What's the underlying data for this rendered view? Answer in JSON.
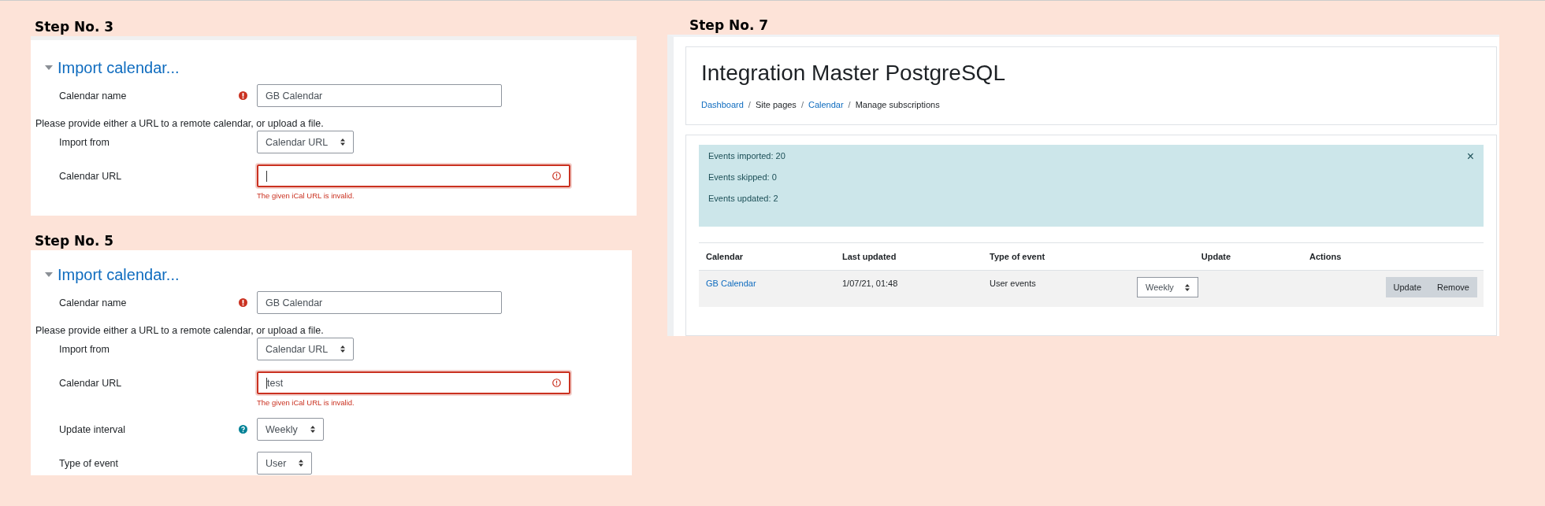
{
  "steps": [
    {
      "kind": "form",
      "title": "Step No. 3",
      "section": "Import calendar...",
      "fields": [
        {
          "kind": "text",
          "label": "Calendar name",
          "required": true,
          "value": "GB Calendar",
          "invalid": false
        },
        {
          "kind": "note",
          "text": "Please provide either a URL to a remote calendar, or upload a file."
        },
        {
          "kind": "select",
          "label": "Import from",
          "value": "Calendar URL"
        },
        {
          "kind": "url",
          "label": "Calendar URL",
          "invalid": true,
          "error": "The given iCal URL is invalid."
        }
      ]
    },
    {
      "kind": "form",
      "title": "Step No. 5",
      "section": "Import calendar...",
      "fields": [
        {
          "kind": "text",
          "label": "Calendar name",
          "required": true,
          "value": "GB Calendar",
          "invalid": false
        },
        {
          "kind": "note",
          "text": "Please provide either a URL to a remote calendar, or upload a file."
        },
        {
          "kind": "select",
          "label": "Import from",
          "value": "Calendar URL"
        },
        {
          "kind": "url",
          "label": "Calendar URL",
          "value": "test",
          "invalid": true,
          "error": "The given iCal URL is invalid."
        },
        {
          "kind": "select",
          "label": "Update interval",
          "help": true,
          "value": "Weekly"
        },
        {
          "kind": "select",
          "label": "Type of event",
          "value": "User"
        }
      ]
    },
    {
      "kind": "page",
      "title": "Step No. 7",
      "heading": "Integration Master PostgreSQL",
      "breadcrumb": [
        {
          "text": "Dashboard",
          "link": true
        },
        {
          "text": "Site pages",
          "link": false
        },
        {
          "text": "Calendar",
          "link": true
        },
        {
          "text": "Manage subscriptions",
          "link": false
        }
      ],
      "breadcrumb_separators": [
        "/",
        "/",
        "/"
      ],
      "alert": {
        "lines": [
          "Events imported: 20",
          "Events skipped: 0",
          "Events updated: 2"
        ],
        "close": "×"
      },
      "table": {
        "columns": [
          "Calendar",
          "Last updated",
          "Type of event",
          "Update",
          "Actions"
        ],
        "rows": [
          {
            "calendar": "GB Calendar",
            "last_updated": "1/07/21, 01:48",
            "type": "User events",
            "update": "Weekly",
            "actions": [
              "Update",
              "Remove"
            ]
          }
        ]
      }
    }
  ]
}
